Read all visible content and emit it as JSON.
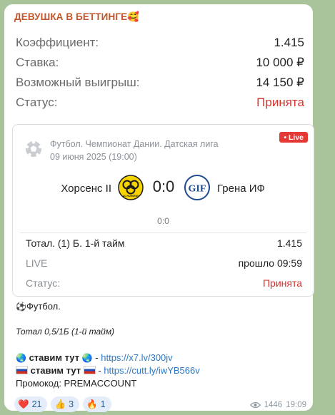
{
  "channel": {
    "name": "ДЕВУШКА В БЕТТИНГЕ",
    "emoji": "🥰"
  },
  "bet": [
    {
      "label": "Коэффициент:",
      "value": "1.415"
    },
    {
      "label": "Ставка:",
      "value": "10 000 ₽"
    },
    {
      "label": "Возможный выигрыш:",
      "value": "14 150 ₽"
    },
    {
      "label": "Статус:",
      "value": "Принята"
    }
  ],
  "match": {
    "league": "Футбол. Чемпионат Дании. Датская лига",
    "date": "09 июня 2025 (19:00)",
    "live_badge": "• Live",
    "team1": "Хорсенс II",
    "team2": "Грена ИФ",
    "score": "0:0",
    "subscore": "0:0",
    "team1_logo_text": "AC HORSENS",
    "team2_logo_text": "GIF"
  },
  "details": [
    {
      "label": "Тотал. (1) Б. 1-й тайм",
      "value": "1.415"
    },
    {
      "label": "LIVE",
      "value": "прошло 09:59"
    },
    {
      "label": "Статус:",
      "value": "Принята"
    }
  ],
  "message": {
    "sport_emoji": "⚽",
    "sport": "Футбол.",
    "bet_text": "Тотал 0,5/1Б (1-й тайм)",
    "globe_emoji": "🌏",
    "line1_label": "ставим тут",
    "line1_link": "https://x7.lv/300jv",
    "line2_label": "ставим тут",
    "line2_link": "https://cutt.ly/iwYB566v",
    "promo": "Промокод: PREMACCOUNT",
    "dash": "-"
  },
  "reactions": [
    {
      "emoji": "❤️",
      "count": "21"
    },
    {
      "emoji": "👍",
      "count": "3"
    },
    {
      "emoji": "🔥",
      "count": "1"
    }
  ],
  "views": "1446",
  "time": "19:09",
  "colors": {
    "accent_red": "#d8322e",
    "link": "#2a79c7",
    "background": "#a9c49a"
  }
}
